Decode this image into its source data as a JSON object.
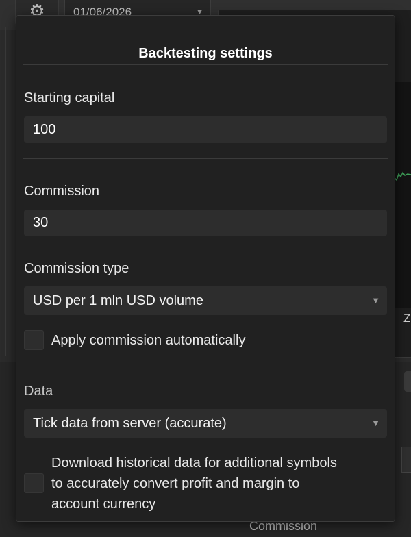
{
  "toolbar": {
    "date_value": "01/06/2026"
  },
  "background": {
    "z_label": "Z",
    "commission_label": "Commission"
  },
  "popup": {
    "title": "Backtesting settings",
    "starting_capital_label": "Starting capital",
    "starting_capital_value": "100",
    "commission_label": "Commission",
    "commission_value": "30",
    "commission_type_label": "Commission type",
    "commission_type_value": "USD per 1 mln USD volume",
    "apply_commission_label": "Apply commission automatically",
    "apply_commission_checked": false,
    "data_label": "Data",
    "data_value": "Tick data from server (accurate)",
    "download_label_1": "Download historical data for additional symbols",
    "download_label_2": "to accurately convert profit and margin to",
    "download_label_3": "account currency",
    "download_checked": false
  },
  "icons": [
    "gear-icon",
    "chevron-down-icon"
  ],
  "colors": {
    "popup_bg": "#212121",
    "field_bg": "#2d2d2d",
    "chart_green": "#2f7a44",
    "chart_red": "#c9603a"
  }
}
